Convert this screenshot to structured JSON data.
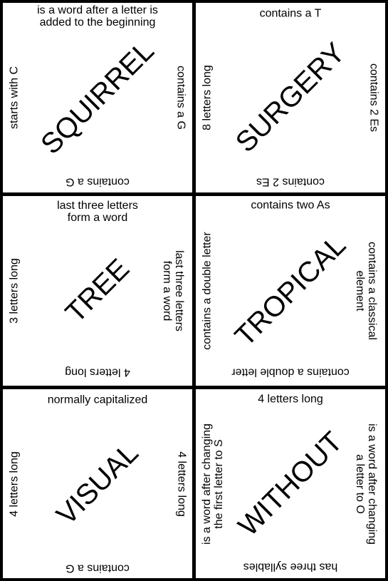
{
  "cards": [
    {
      "word": "SQUIRREL",
      "top": "is a word after a letter is\nadded to the beginning",
      "right": "contains a G",
      "bottom": "contains a G",
      "left": "starts with C"
    },
    {
      "word": "SURGERY",
      "top": "contains a T",
      "right": "contains 2 Es",
      "bottom": "contains 2 Es",
      "left": "8 letters long"
    },
    {
      "word": "TREE",
      "top": "last three letters\nform a word",
      "right": "last three letters\nform a word",
      "bottom": "4 letters long",
      "left": "3 letters long"
    },
    {
      "word": "TROPICAL",
      "top": "contains two As",
      "right": "contains a classical\nelement",
      "bottom": "contains a double letter",
      "left": "contains a double letter"
    },
    {
      "word": "VISUAL",
      "top": "normally capitalized",
      "right": "4 letters long",
      "bottom": "contains a G",
      "left": "4 letters long"
    },
    {
      "word": "WITHOUT",
      "top": "4 letters long",
      "right": "is a word after changing\na letter to O",
      "bottom": "has three syllables",
      "left": "is a word after changing\nthe first letter to S"
    }
  ]
}
